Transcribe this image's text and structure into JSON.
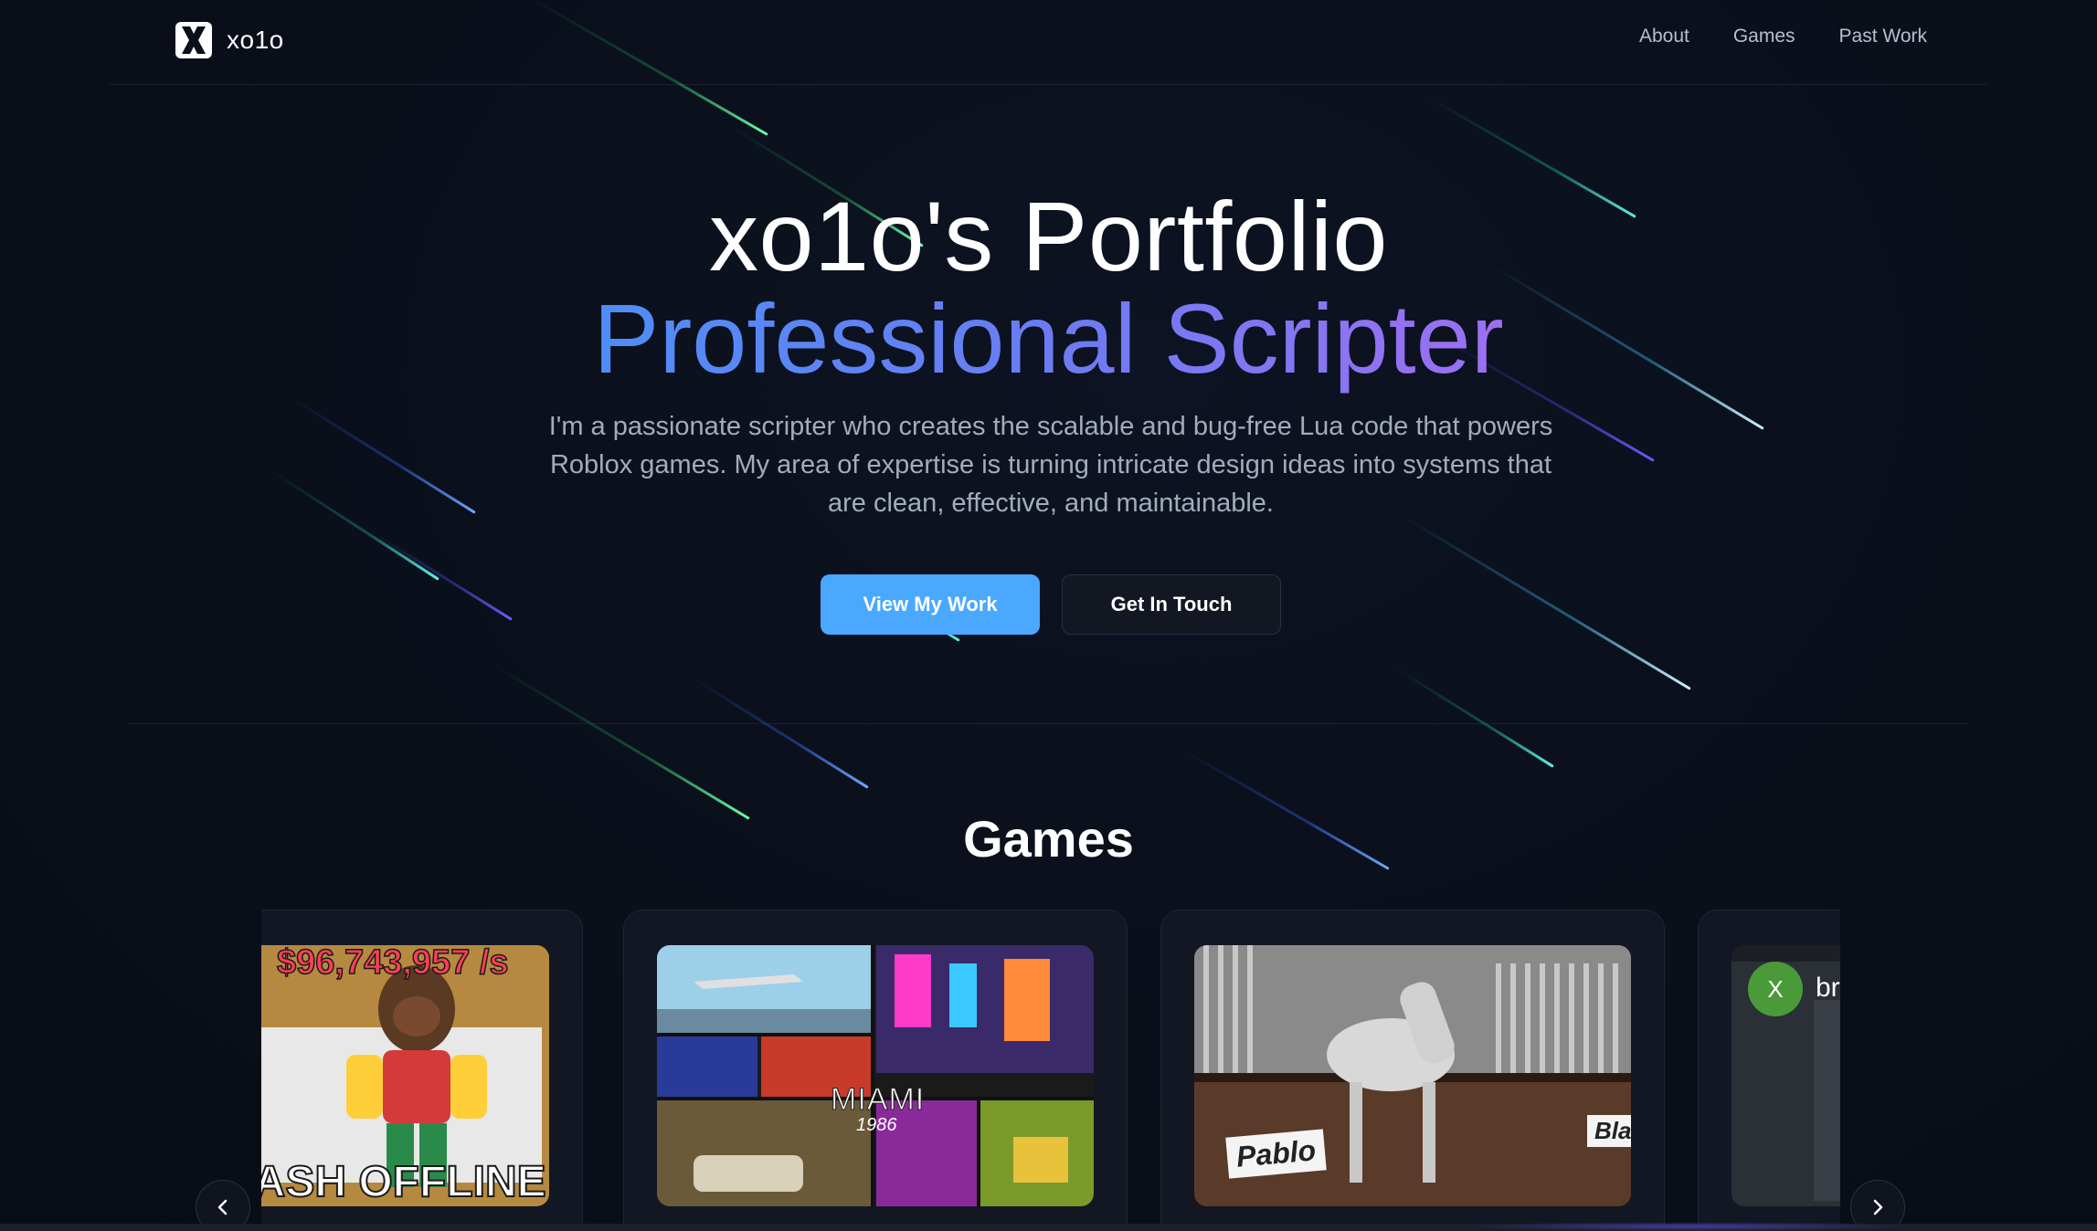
{
  "nav": {
    "brand_name": "xo1o",
    "logo_letter": "X",
    "links": [
      "About",
      "Games",
      "Past Work"
    ]
  },
  "hero": {
    "title": "xo1o's Portfolio",
    "subtitle": "Professional Scripter",
    "description": "I'm a passionate scripter who creates the scalable and bug-free Lua code that powers Roblox games. My area of expertise is turning intricate design ideas into systems that are clean, effective, and maintainable.",
    "primary_button": "View My Work",
    "secondary_button": "Get In Touch"
  },
  "games": {
    "title": "Games",
    "cards": [
      {
        "thumb_text_top": "$96,743,957 /s",
        "thumb_text_bottom": "CASH OFFLINE"
      },
      {
        "thumb_text_top": "MIAMI",
        "thumb_text_bottom": "1986"
      },
      {
        "thumb_text_top": "Pablo",
        "thumb_text_bottom": "Blaz"
      },
      {
        "thumb_text_top": "X",
        "thumb_text_bottom": "br"
      }
    ]
  },
  "colors": {
    "primary_button": "#4aa8ff",
    "gradient_start": "#4f8df7",
    "gradient_end": "#9d6ff2",
    "background": "#0a0f1a"
  }
}
